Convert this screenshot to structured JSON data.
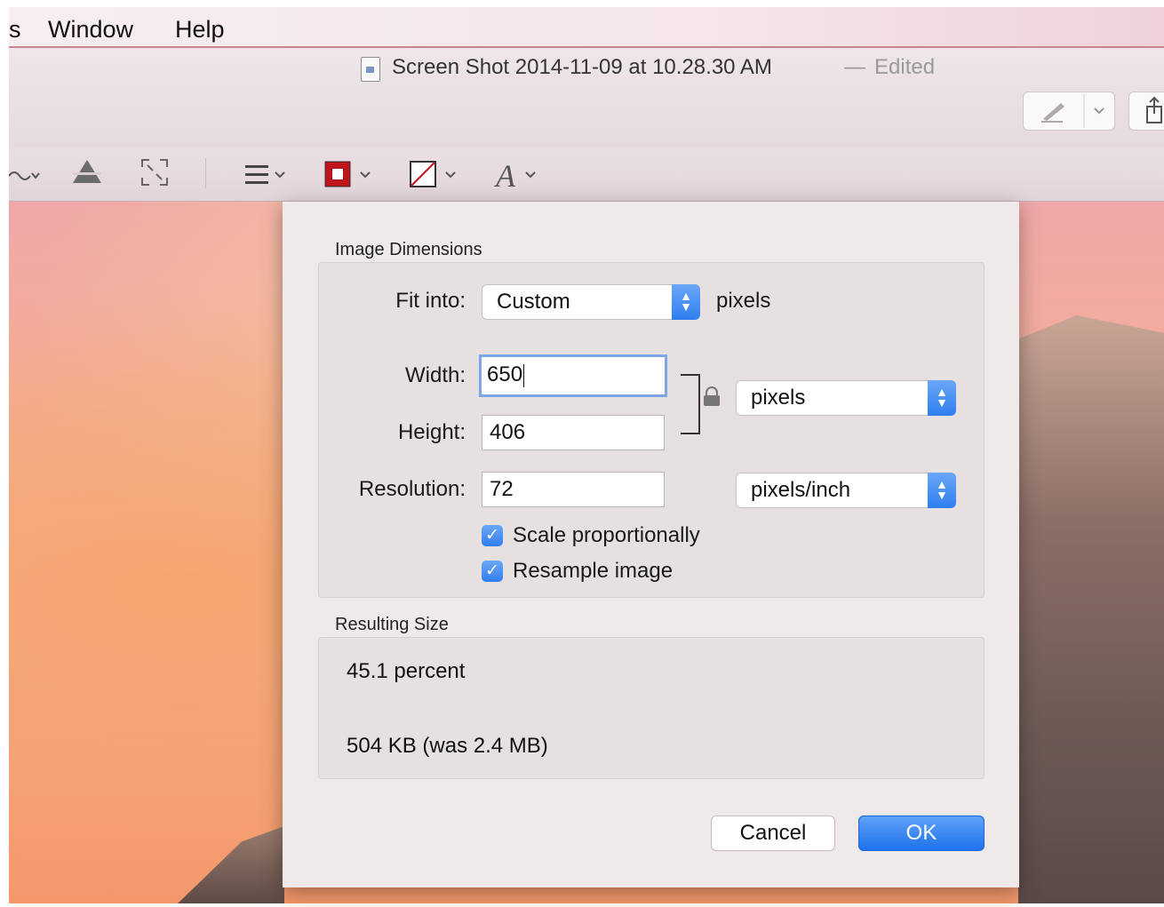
{
  "menubar": {
    "items": [
      "s",
      "Window",
      "Help"
    ]
  },
  "window": {
    "title": "Screen Shot 2014-11-09 at 10.28.30 AM",
    "separator": "—",
    "edited": "Edited"
  },
  "dialog": {
    "image_dimensions": {
      "title": "Image Dimensions",
      "fit_into_label": "Fit into:",
      "fit_into_value": "Custom",
      "fit_into_unit": "pixels",
      "width_label": "Width:",
      "width_value": "650",
      "height_label": "Height:",
      "height_value": "406",
      "size_unit": "pixels",
      "resolution_label": "Resolution:",
      "resolution_value": "72",
      "resolution_unit": "pixels/inch",
      "scale_proportionally": {
        "label": "Scale proportionally",
        "checked": true
      },
      "resample_image": {
        "label": "Resample image",
        "checked": true
      }
    },
    "resulting_size": {
      "title": "Resulting Size",
      "percent": "45.1 percent",
      "file_size": "504 KB (was 2.4 MB)"
    },
    "buttons": {
      "cancel": "Cancel",
      "ok": "OK"
    }
  },
  "icons": {
    "checkmark": "✓",
    "chevron_down": "⌄",
    "stepper": "⌃⌄",
    "lines": "☰",
    "font": "A"
  },
  "colors": {
    "accent": "#2f7ef0",
    "border_color_swatch": "#c0141c"
  }
}
